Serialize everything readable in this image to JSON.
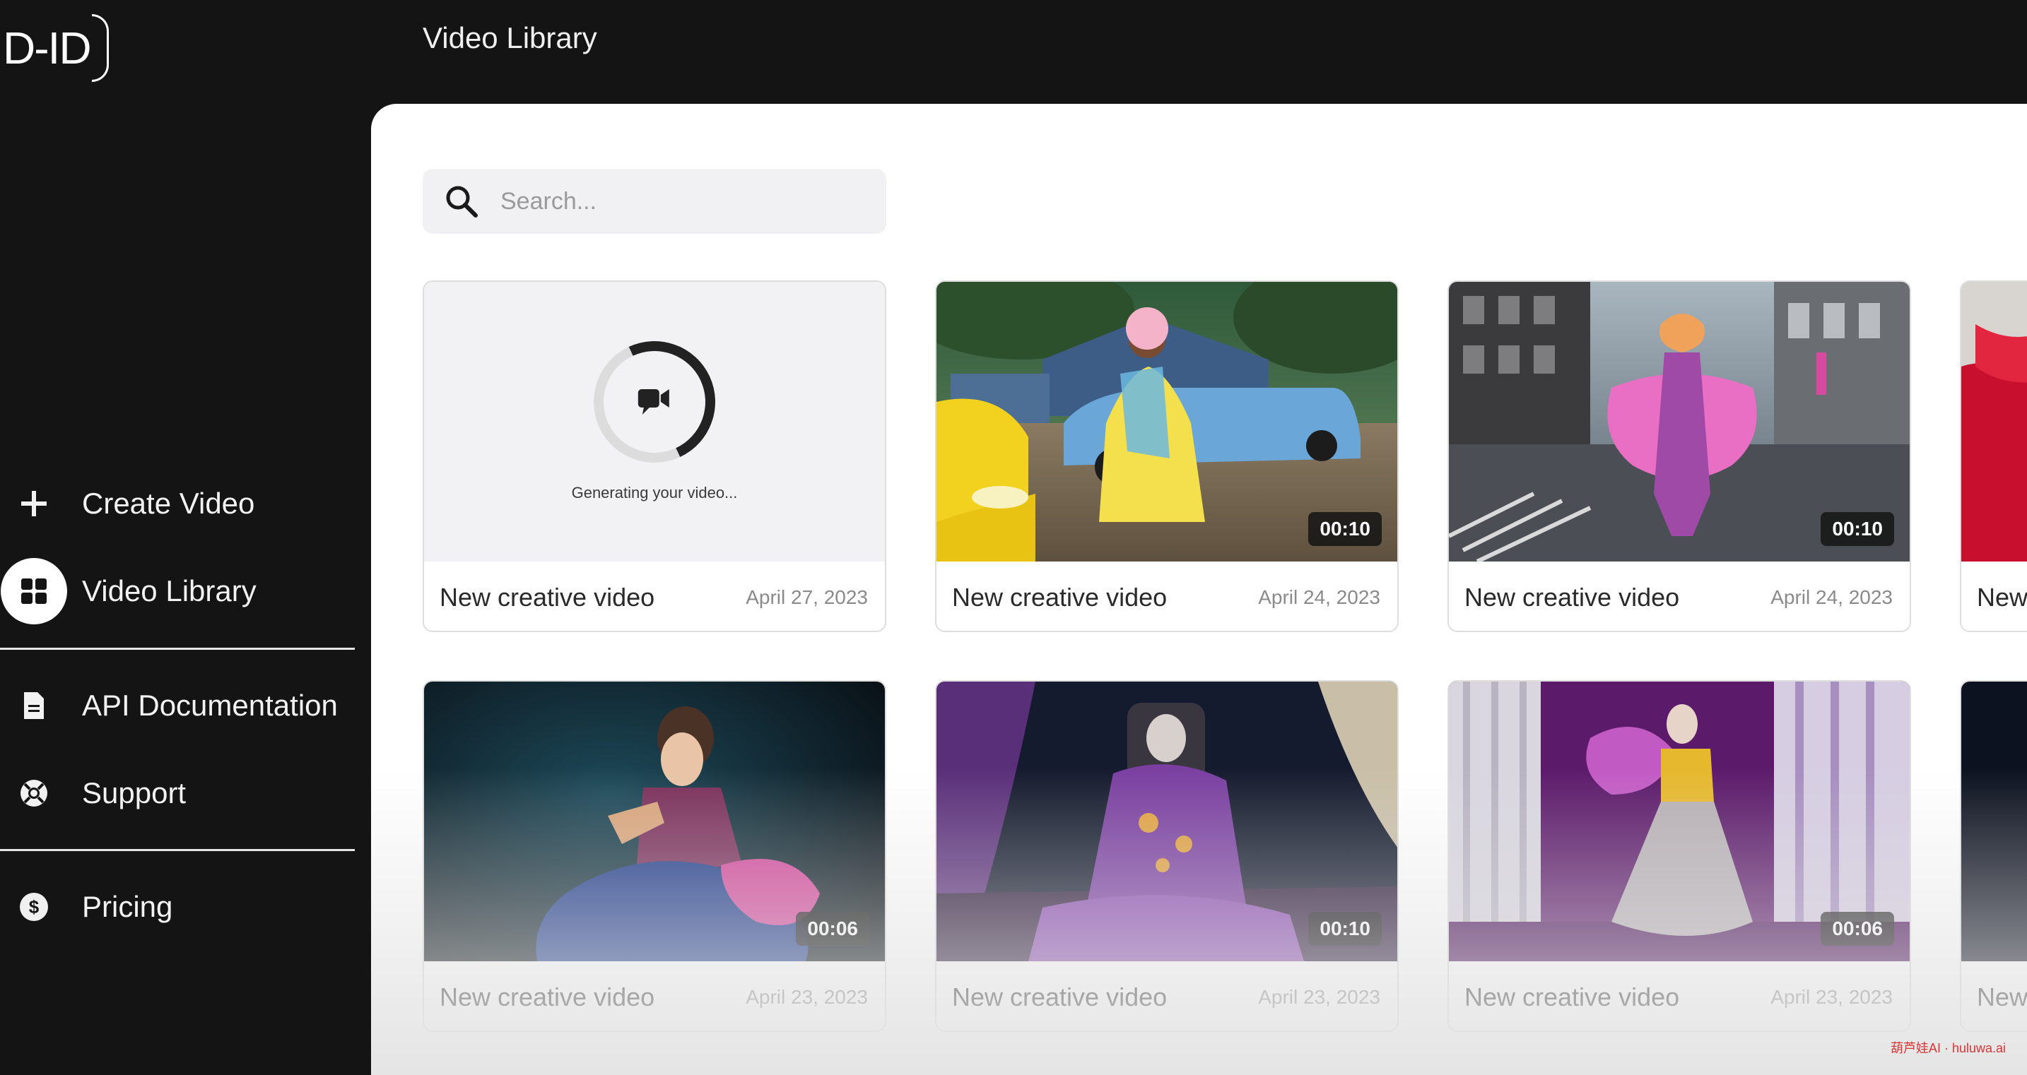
{
  "app": {
    "logo_text": "D-ID"
  },
  "header": {
    "title": "Video Library"
  },
  "sidebar": {
    "items": [
      {
        "label": "Create Video",
        "icon": "plus-icon"
      },
      {
        "label": "Video Library",
        "icon": "grid-icon",
        "active": true
      },
      {
        "label": "API Documentation",
        "icon": "document-icon"
      },
      {
        "label": "Support",
        "icon": "lifebuoy-icon"
      },
      {
        "label": "Pricing",
        "icon": "dollar-icon"
      }
    ]
  },
  "search": {
    "placeholder": "Search..."
  },
  "cards": [
    {
      "title": "New creative video",
      "date": "April 27, 2023",
      "status": "Generating your video...",
      "duration": ""
    },
    {
      "title": "New creative video",
      "date": "April 24, 2023",
      "duration": "00:10"
    },
    {
      "title": "New creative video",
      "date": "April 24, 2023",
      "duration": "00:10"
    },
    {
      "title": "New creative video",
      "date": "April 23, 2023",
      "duration": "00:06"
    },
    {
      "title": "New creative video",
      "date": "April 23, 2023",
      "duration": "00:10"
    },
    {
      "title": "New creative video",
      "date": "April 23, 2023",
      "duration": "00:06"
    }
  ],
  "partial_cards": [
    {
      "title_fragment": "New"
    },
    {
      "title_fragment": "New"
    }
  ],
  "watermark": "葫芦娃AI · huluwa.ai",
  "colors": {
    "background": "#141414",
    "panel": "#ffffff",
    "accent": "#ffffff"
  }
}
